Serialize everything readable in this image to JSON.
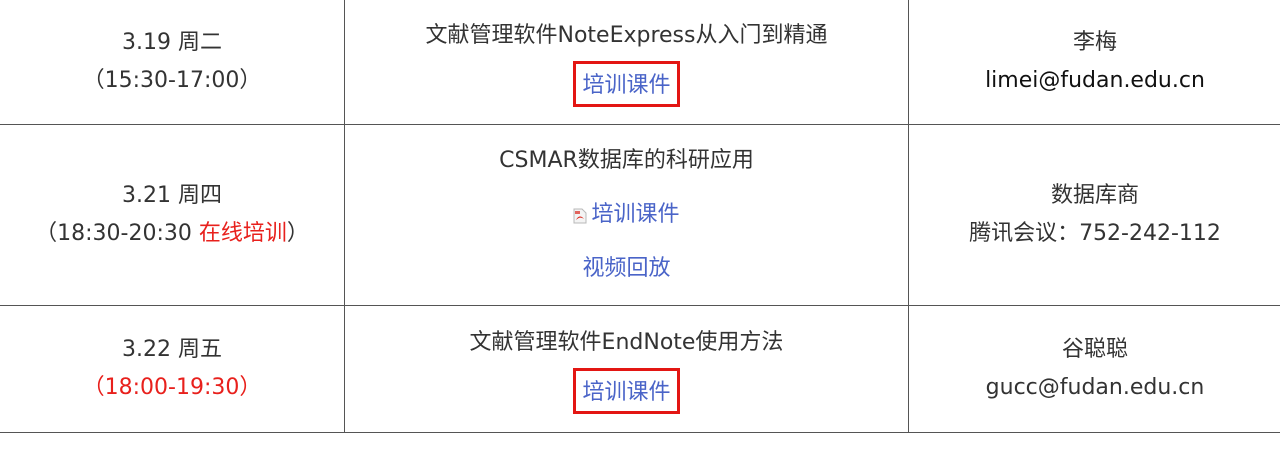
{
  "rows": [
    {
      "date": "3.19 周二",
      "time": "（15:30-17:00）",
      "title": "文献管理软件NoteExpress从入门到精通",
      "courseware": "培训课件",
      "contact_name": "李梅",
      "contact_info": "limei@fudan.edu.cn"
    },
    {
      "date": "3.21 周四",
      "time_prefix": "（18:30-20:30 ",
      "time_online": "在线培训",
      "time_suffix": "）",
      "title": "CSMAR数据库的科研应用",
      "courseware": "培训课件",
      "video": "视频回放",
      "contact_name": "数据库商",
      "contact_info": "腾讯会议：752-242-112"
    },
    {
      "date": "3.22 周五",
      "time": "（18:00-19:30）",
      "title": "文献管理软件EndNote使用方法",
      "courseware": "培训课件",
      "contact_name": "谷聪聪",
      "contact_info": "gucc@fudan.edu.cn"
    }
  ],
  "colors": {
    "link": "#4a64c8",
    "highlight_red": "#e8201c",
    "box_border": "#e31613",
    "grid": "#555555"
  },
  "icons": [
    "pdf-file-icon"
  ]
}
